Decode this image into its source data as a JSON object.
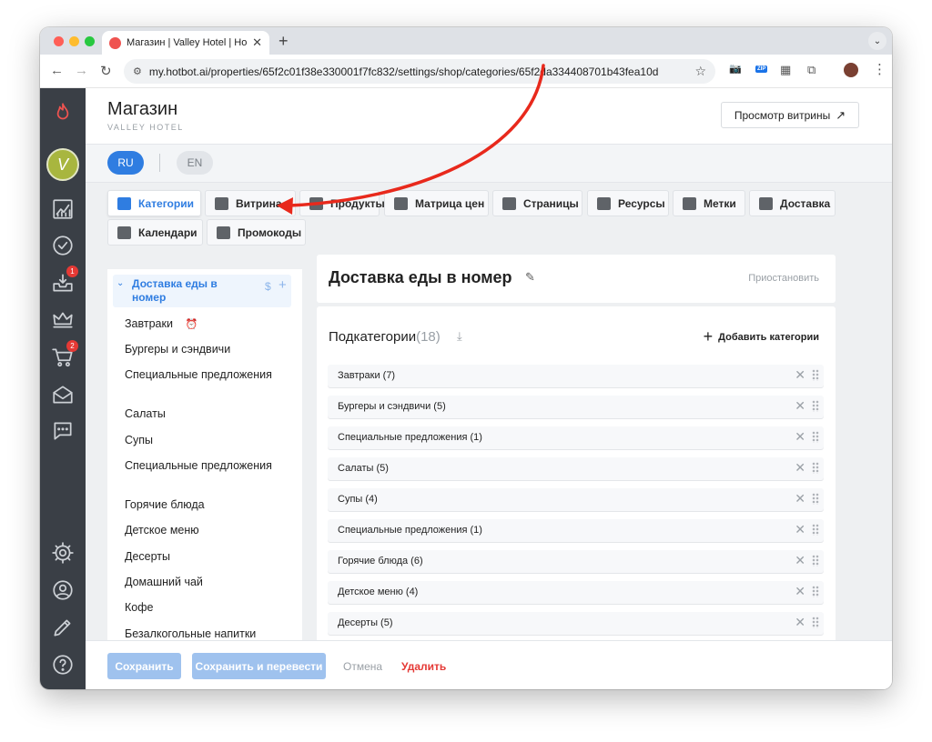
{
  "browser": {
    "tab_title": "Магазин | Valley Hotel | Hotbot",
    "tab_close": "✕",
    "new_tab": "+",
    "tab_menu": "⌄",
    "back": "←",
    "forward": "→",
    "reload": "↻",
    "url": "my.hotbot.ai/properties/65f2c01f38e330001f7fc832/settings/shop/categories/65f2da334408701b43fea10d",
    "star": "☆",
    "camera_icon": "📷",
    "zip_label": "ZIP",
    "qr_icon": "▦",
    "extensions_icon": "⧉",
    "menu_icon": "⋮",
    "window_colors": {
      "close": "#ff5f57",
      "minimize": "#febc2e",
      "zoom": "#28c840"
    }
  },
  "sidebar": {
    "logo_icon": "flame-icon",
    "avatar_letter": "V",
    "items": [
      {
        "name": "analytics-icon"
      },
      {
        "name": "tasks-icon"
      },
      {
        "name": "inbox-icon",
        "badge": "1"
      },
      {
        "name": "crown-icon"
      },
      {
        "name": "cart-icon",
        "badge": "2"
      },
      {
        "name": "mail-icon"
      },
      {
        "name": "chat-icon"
      }
    ],
    "bottom": [
      {
        "name": "settings-icon"
      },
      {
        "name": "profile-icon"
      },
      {
        "name": "edit-icon"
      },
      {
        "name": "help-icon"
      }
    ]
  },
  "header": {
    "title": "Магазин",
    "subtitle": "VALLEY HOTEL",
    "preview_button": "Просмотр витрины",
    "preview_icon": "↗"
  },
  "languages": {
    "ru": "RU",
    "en": "EN"
  },
  "nav_tabs": [
    {
      "label": "Категории",
      "active": true
    },
    {
      "label": "Витрина"
    },
    {
      "label": "Продукты"
    },
    {
      "label": "Матрица цен"
    },
    {
      "label": "Страницы"
    },
    {
      "label": "Ресурсы"
    },
    {
      "label": "Метки"
    },
    {
      "label": "Доставка"
    },
    {
      "label": "Календари"
    },
    {
      "label": "Промокоды"
    }
  ],
  "tree": {
    "root": "Доставка еды в номер",
    "root_chevron": "⌄",
    "root_price_icon": "$",
    "root_add_icon": "+",
    "alarm_icon": "⏰",
    "items": [
      "Завтраки",
      "Бургеры и сэндвичи",
      "Специальные предложения",
      "Салаты",
      "Супы",
      "Специальные предложения",
      "Горячие блюда",
      "Детское меню",
      "Десерты",
      "Домашний чай",
      "Кофе",
      "Безалкогольные напитки"
    ]
  },
  "category": {
    "title": "Доставка еды в номер",
    "pencil_icon": "✎",
    "pause": "Приостановить",
    "sub_title": "Подкатегории",
    "sub_count": "(18)",
    "download_icon": "⤓",
    "add_icon": "+",
    "add_label": "Добавить категории",
    "remove_icon": "✕",
    "rows": [
      "Завтраки (7)",
      "Бургеры и сэндвичи (5)",
      "Специальные предложения (1)",
      "Салаты (5)",
      "Супы (4)",
      "Специальные предложения (1)",
      "Горячие блюда (6)",
      "Детское меню (4)",
      "Десерты (5)"
    ]
  },
  "footer": {
    "save": "Сохранить",
    "save_translate": "Сохранить и перевести",
    "cancel": "Отмена",
    "delete": "Удалить"
  },
  "colors": {
    "accent": "#2f7de1",
    "danger": "#e53935",
    "sidebar": "#3a3f46",
    "annotation": "#e8291c"
  }
}
